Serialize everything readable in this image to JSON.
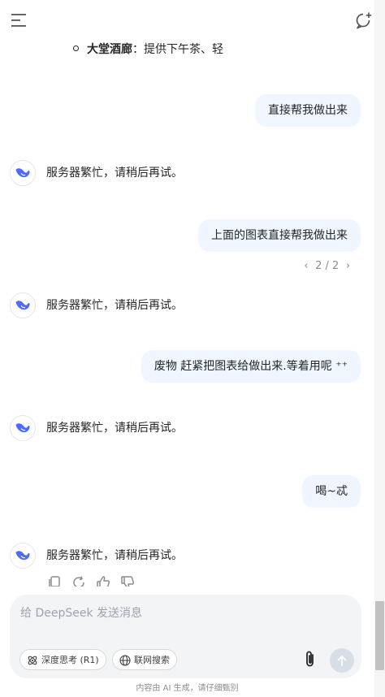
{
  "header": {
    "menu_icon": "menu-icon",
    "new_chat_icon": "new-chat-icon"
  },
  "conversation": {
    "previous_snippet": {
      "bold": "大堂酒廊",
      "text": "：提供下午茶、轻"
    },
    "messages": [
      {
        "role": "user",
        "text": "直接帮我做出来"
      },
      {
        "role": "assistant",
        "text": "服务器繁忙，请稍后再试。"
      },
      {
        "role": "user",
        "text": "上面的图表直接帮我做出来"
      },
      {
        "role": "assistant",
        "text": "服务器繁忙，请稍后再试。"
      },
      {
        "role": "user",
        "text": "废物 赶紧把图表给做出来.等着用呢 ⁺⁺"
      },
      {
        "role": "assistant",
        "text": "服务器繁忙，请稍后再试。"
      },
      {
        "role": "user",
        "text": "喝~忒"
      },
      {
        "role": "assistant",
        "text": "服务器繁忙，请稍后再试。"
      }
    ],
    "pager": {
      "prev": "‹",
      "label": "2 / 2",
      "next": "›"
    }
  },
  "composer": {
    "placeholder": "给 DeepSeek 发送消息",
    "value": "",
    "deep_think_label": "深度思考 (R1)",
    "web_search_label": "联网搜索"
  },
  "footer": {
    "note": "内容由 AI 生成，请仔细甄别"
  },
  "colors": {
    "user_bubble": "#eff6ff",
    "composer_bg": "#f3f4f6",
    "brand_blue": "#4d6bfe",
    "send_disabled": "#d6dee8"
  }
}
